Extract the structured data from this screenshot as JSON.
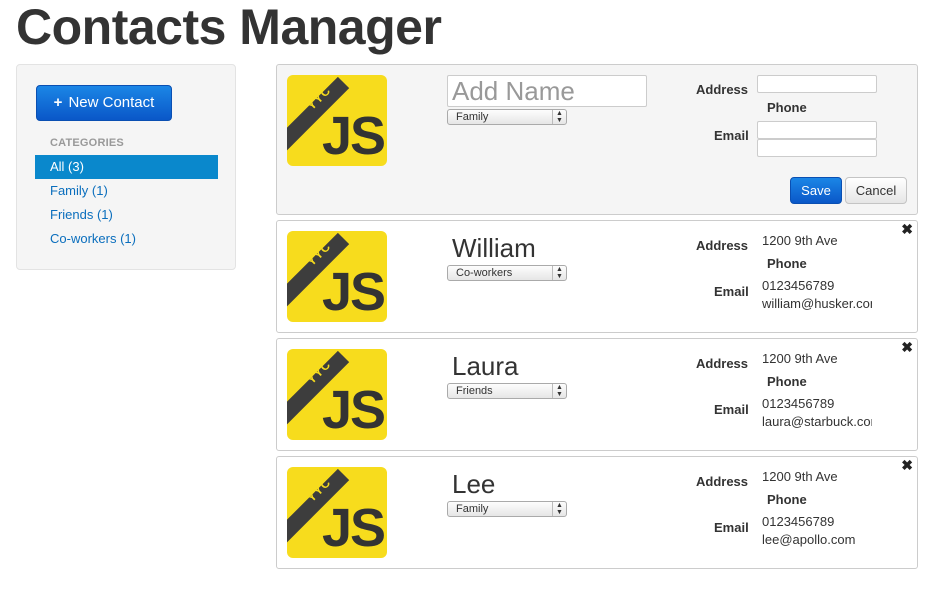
{
  "page": {
    "title": "Contacts Manager"
  },
  "sidebar": {
    "new_contact_label": "New Contact",
    "categories_header": "CATEGORIES",
    "categories": [
      {
        "label": "All (3)",
        "active": true
      },
      {
        "label": "Family (1)",
        "active": false
      },
      {
        "label": "Friends (1)",
        "active": false
      },
      {
        "label": "Co-workers (1)",
        "active": false
      }
    ]
  },
  "logo": {
    "badge": "YYC",
    "text": "JS"
  },
  "form": {
    "name_placeholder": "Add Name",
    "category": "Family",
    "address_label": "Address",
    "phone_label": "Phone",
    "email_label": "Email",
    "save_label": "Save",
    "cancel_label": "Cancel"
  },
  "contacts": [
    {
      "name": "William",
      "category": "Co-workers",
      "address_label": "Address",
      "address": "1200 9th Ave",
      "phone_label": "Phone",
      "email_label": "Email",
      "phone": "0123456789",
      "email": "william@husker.com"
    },
    {
      "name": "Laura",
      "category": "Friends",
      "address_label": "Address",
      "address": "1200 9th Ave",
      "phone_label": "Phone",
      "email_label": "Email",
      "phone": "0123456789",
      "email": "laura@starbuck.com"
    },
    {
      "name": "Lee",
      "category": "Family",
      "address_label": "Address",
      "address": "1200 9th Ave",
      "phone_label": "Phone",
      "email_label": "Email",
      "phone": "0123456789",
      "email": "lee@apollo.com"
    }
  ],
  "colors": {
    "accent": "#0a88cc",
    "button_primary": "#0a57c8",
    "logo_yellow": "#f7dc1d"
  }
}
